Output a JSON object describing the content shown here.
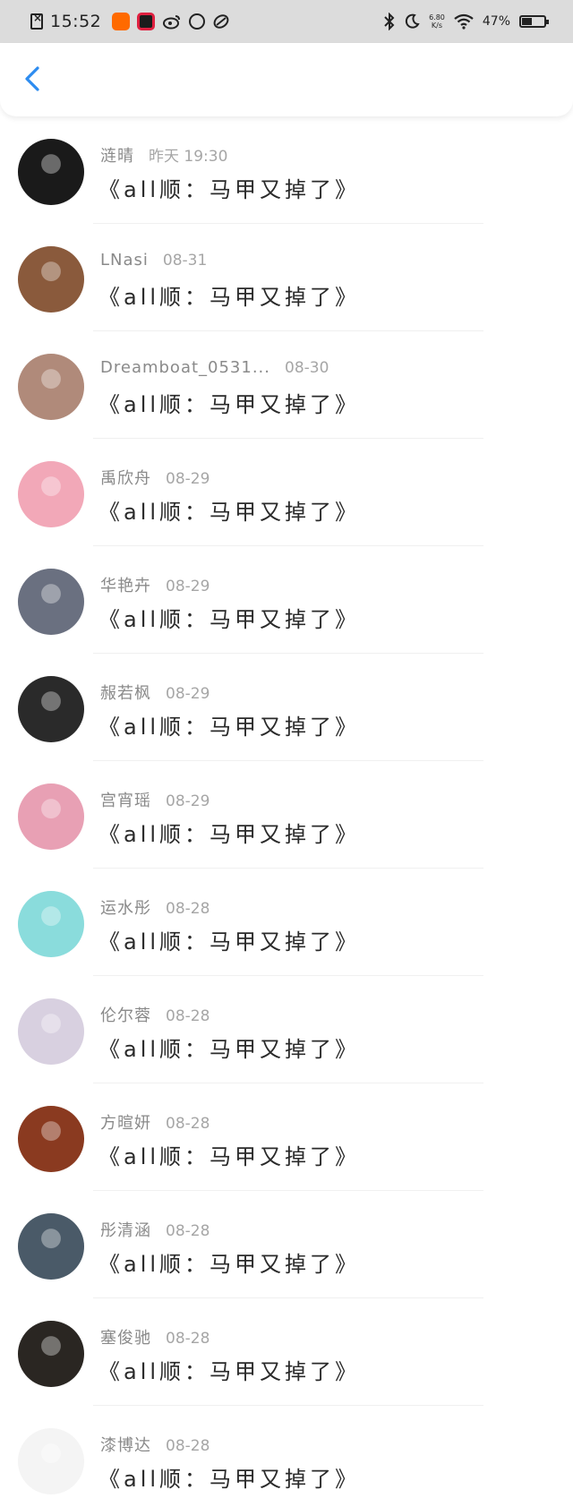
{
  "status_bar": {
    "time": "15:52",
    "speed_value": "6.80",
    "speed_unit": "K/s",
    "battery_text": "47%",
    "battery_level": 0.47,
    "icons": [
      "sim-off-icon",
      "app-icon",
      "app-icon",
      "weibo-icon",
      "search-app-icon",
      "link-app-icon",
      "bluetooth-icon",
      "moon-icon",
      "wifi-icon",
      "battery-icon"
    ]
  },
  "header": {
    "back_icon": "chevron-left-icon",
    "accent_color": "#2d8cf0"
  },
  "items": [
    {
      "name": "涟晴",
      "time": "昨天 19:30",
      "message": "《all顺：马甲又掉了》",
      "avatar_color": "#1a1a1a"
    },
    {
      "name": "LNasi",
      "time": "08-31",
      "message": "《all顺：马甲又掉了》",
      "avatar_color": "#8a5a3c"
    },
    {
      "name": "Dreamboat_0531...",
      "time": "08-30",
      "message": "《all顺：马甲又掉了》",
      "avatar_color": "#b08a7a"
    },
    {
      "name": "禹欣舟",
      "time": "08-29",
      "message": "《all顺：马甲又掉了》",
      "avatar_color": "#f2a8b8"
    },
    {
      "name": "华艳卉",
      "time": "08-29",
      "message": "《all顺：马甲又掉了》",
      "avatar_color": "#6a7080"
    },
    {
      "name": "赧若枫",
      "time": "08-29",
      "message": "《all顺：马甲又掉了》",
      "avatar_color": "#2a2a2a"
    },
    {
      "name": "宫宵瑶",
      "time": "08-29",
      "message": "《all顺：马甲又掉了》",
      "avatar_color": "#e8a0b4"
    },
    {
      "name": "运水彤",
      "time": "08-28",
      "message": "《all顺：马甲又掉了》",
      "avatar_color": "#8adcdc"
    },
    {
      "name": "伦尔蓉",
      "time": "08-28",
      "message": "《all顺：马甲又掉了》",
      "avatar_color": "#d8d0e0"
    },
    {
      "name": "方暄妍",
      "time": "08-28",
      "message": "《all顺：马甲又掉了》",
      "avatar_color": "#8a3a20"
    },
    {
      "name": "彤清涵",
      "time": "08-28",
      "message": "《all顺：马甲又掉了》",
      "avatar_color": "#4a5a68"
    },
    {
      "name": "塞俊驰",
      "time": "08-28",
      "message": "《all顺：马甲又掉了》",
      "avatar_color": "#2a2622"
    },
    {
      "name": "漆博达",
      "time": "08-28",
      "message": "《all顺：马甲又掉了》",
      "avatar_color": "#f4f4f4"
    }
  ]
}
